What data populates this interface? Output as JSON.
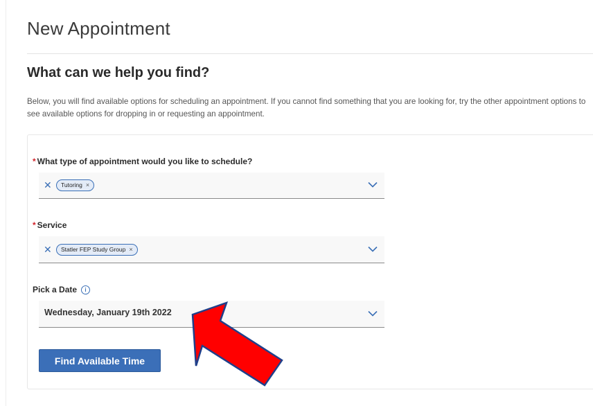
{
  "page": {
    "title": "New Appointment"
  },
  "section": {
    "heading": "What can we help you find?",
    "intro": "Below, you will find available options for scheduling an appointment. If you cannot find something that you are looking for, try the other appointment options to see available options for dropping in or requesting an appointment."
  },
  "form": {
    "appointment_type": {
      "required_marker": "*",
      "label": "What type of appointment would you like to schedule?",
      "clear_glyph": "✕",
      "chip": "Tutoring",
      "chip_remove_glyph": "×"
    },
    "service": {
      "required_marker": "*",
      "label": "Service",
      "clear_glyph": "✕",
      "chip": "Statler FEP Study Group",
      "chip_remove_glyph": "×"
    },
    "date": {
      "label": "Pick a Date",
      "info_glyph": "i",
      "value": "Wednesday, January 19th 2022"
    },
    "submit_label": "Find Available Time"
  },
  "colors": {
    "accent": "#3b6fb8",
    "required": "#d2232a",
    "annotation_arrow": "#ff0000"
  },
  "icons": {
    "clear": "close-icon",
    "dropdown": "chevron-down-icon",
    "info": "info-icon",
    "annotation": "red-arrow-annotation"
  }
}
